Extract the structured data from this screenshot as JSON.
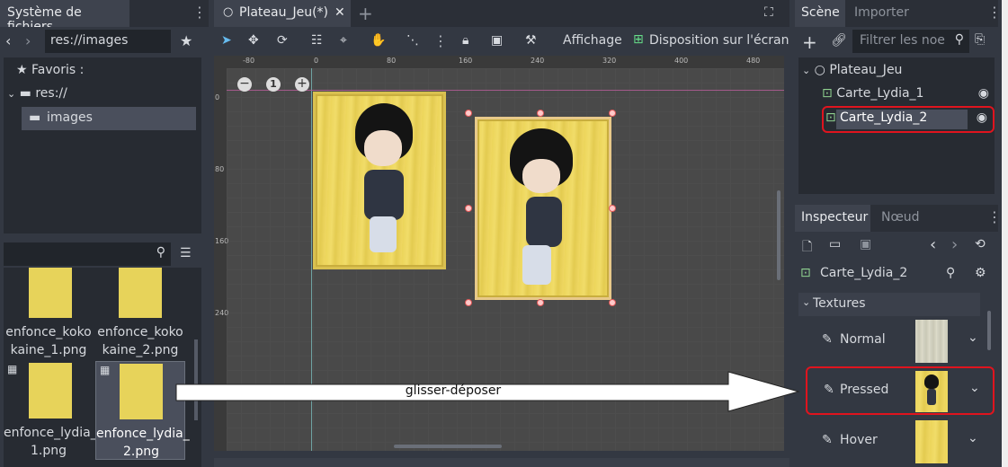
{
  "filesystem": {
    "tab_label": "Système de fichiers",
    "path": "res://images",
    "tree": {
      "favorites": "Favoris :",
      "root": "res://",
      "folder": "images"
    },
    "files": [
      {
        "name": "enfonce_koko\nkaine_1.png"
      },
      {
        "name": "enfonce_koko\nkaine_2.png"
      },
      {
        "name": "enfonce_lydia_\n1.png"
      },
      {
        "name": "enfonce_lydia_\n2.png"
      }
    ]
  },
  "editor": {
    "tab_label": "Plateau_Jeu(*)",
    "toolbar": {
      "view_menu": "Affichage",
      "layout_menu": "Disposition sur l'écran"
    },
    "ruler_top": [
      "-80",
      "0",
      "80",
      "160",
      "240",
      "320",
      "400",
      "480"
    ],
    "ruler_left": [
      "0",
      "80",
      "160",
      "240"
    ],
    "zoom_level": "1"
  },
  "scene": {
    "tabs": [
      "Scène",
      "Importer"
    ],
    "filter_placeholder": "Filtrer les noe",
    "nodes": [
      {
        "name": "Plateau_Jeu"
      },
      {
        "name": "Carte_Lydia_1"
      },
      {
        "name": "Carte_Lydia_2"
      }
    ]
  },
  "inspector": {
    "tabs": [
      "Inspecteur",
      "Nœud"
    ],
    "object_name": "Carte_Lydia_2",
    "section": "Textures",
    "properties": [
      {
        "label": "Normal"
      },
      {
        "label": "Pressed"
      },
      {
        "label": "Hover"
      }
    ]
  },
  "annotation": {
    "arrow_text": "glisser-déposer"
  },
  "colors": {
    "highlight": "#e0141e",
    "accent": "#66bbee",
    "card_yellow": "#ecd55a"
  }
}
